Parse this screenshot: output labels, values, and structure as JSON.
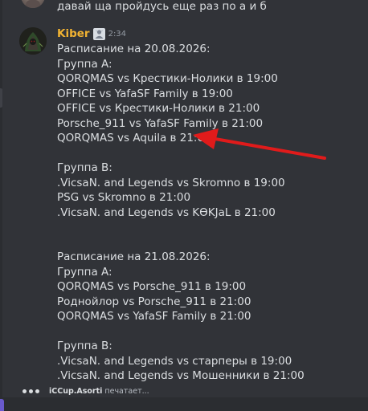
{
  "previous_message": {
    "text": "давай ща пройдусь еще раз по а и б"
  },
  "message": {
    "author": "Kiber",
    "timestamp": "2:34",
    "author_color": "#f0b232",
    "lines": [
      "Расписание на 20.08.2026:",
      "Группа A:",
      "QORQMAS vs Крестики-Нолики в 19:00",
      "OFFICE vs YafaSF Family в 19:00",
      "OFFICE vs Крестики-Нолики в 21:00",
      "Porsche_911 vs YafaSF Family в 21:00",
      "QORQMAS vs Aquila в 21:00",
      "Группа B:",
      ".VicsaN. and Legends vs Skromno в 19:00",
      "PSG vs Skromno в 21:00",
      ".VicsaN. and Legends vs KӨKJaL  в 21:00",
      "Расписание на 21.08.2026:",
      "Группа A:",
      "QORQMAS vs Porsche_911 в 19:00",
      "Роднойлор vs Porsche_911 в 21:00",
      "QORQMAS vs YafaSF Family в 21:00",
      "Группа B:",
      ".VicsaN. and Legends vs старперы в 19:00",
      ".VicsaN. and Legends vs Мошенники в 21:00"
    ]
  },
  "annotation": {
    "color": "#e01b1b",
    "points_to_line": "QORQMAS vs Aquila в 21:00"
  },
  "typing_indicator": {
    "name": "iCCup.Asorti",
    "suffix": "печатает..."
  },
  "theme": {
    "background": "#313338",
    "text": "#dbdee1",
    "muted": "#949ba4"
  }
}
